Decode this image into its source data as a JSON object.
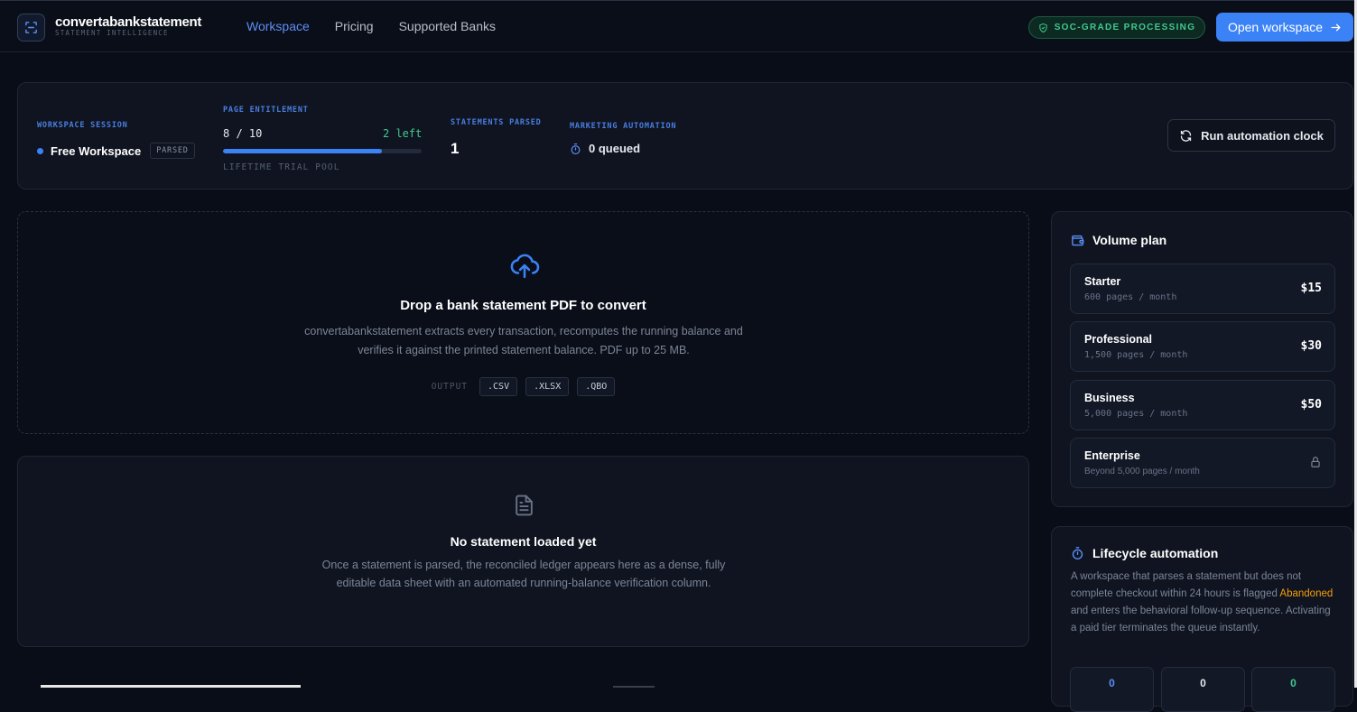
{
  "brand": {
    "name": "convertabankstatement",
    "tagline": "STATEMENT INTELLIGENCE"
  },
  "nav": [
    {
      "label": "Workspace",
      "active": true
    },
    {
      "label": "Pricing"
    },
    {
      "label": "Supported Banks"
    }
  ],
  "header": {
    "soc_badge": "SOC-GRADE PROCESSING",
    "open_button": "Open workspace"
  },
  "stats": {
    "session": {
      "label": "WORKSPACE SESSION",
      "value": "Free Workspace",
      "tag": "PARSED"
    },
    "entitlement": {
      "label": "PAGE ENTITLEMENT",
      "count": "8 / 10",
      "left": "2 left",
      "progress_fraction": 0.8,
      "footnote": "LIFETIME TRIAL POOL"
    },
    "parsed": {
      "label": "STATEMENTS PARSED",
      "value": "1"
    },
    "marketing": {
      "label": "MARKETING AUTOMATION",
      "value": "0 queued"
    },
    "run_button": "Run automation clock"
  },
  "dropzone": {
    "title": "Drop a bank statement PDF to convert",
    "description": "convertabankstatement extracts every transaction, recomputes the running balance and verifies it against the printed statement balance. PDF up to 25 MB.",
    "output_label": "OUTPUT",
    "formats": [
      ".CSV",
      ".XLSX",
      ".QBO"
    ]
  },
  "empty_state": {
    "title": "No statement loaded yet",
    "description": "Once a statement is parsed, the reconciled ledger appears here as a dense, fully editable data sheet with an automated running-balance verification column."
  },
  "volume_plan": {
    "title": "Volume plan",
    "plans": [
      {
        "name": "Starter",
        "sub": "600 pages / month",
        "price": "$15"
      },
      {
        "name": "Professional",
        "sub": "1,500 pages / month",
        "price": "$30"
      },
      {
        "name": "Business",
        "sub": "5,000 pages / month",
        "price": "$50"
      },
      {
        "name": "Enterprise",
        "sub": "Beyond 5,000 pages / month",
        "price": ""
      }
    ]
  },
  "lifecycle": {
    "title": "Lifecycle automation",
    "desc_before": "A workspace that parses a statement but does not complete checkout within 24 hours is flagged ",
    "desc_highlight": "Abandoned",
    "desc_after": " and enters the behavioral follow-up sequence. Activating a paid tier terminates the queue instantly.",
    "counters": [
      "0",
      "0",
      "0"
    ]
  },
  "colors": {
    "accent": "#3b82f6",
    "success": "#41c990",
    "warning": "#f59e0b",
    "background": "#090d17"
  }
}
